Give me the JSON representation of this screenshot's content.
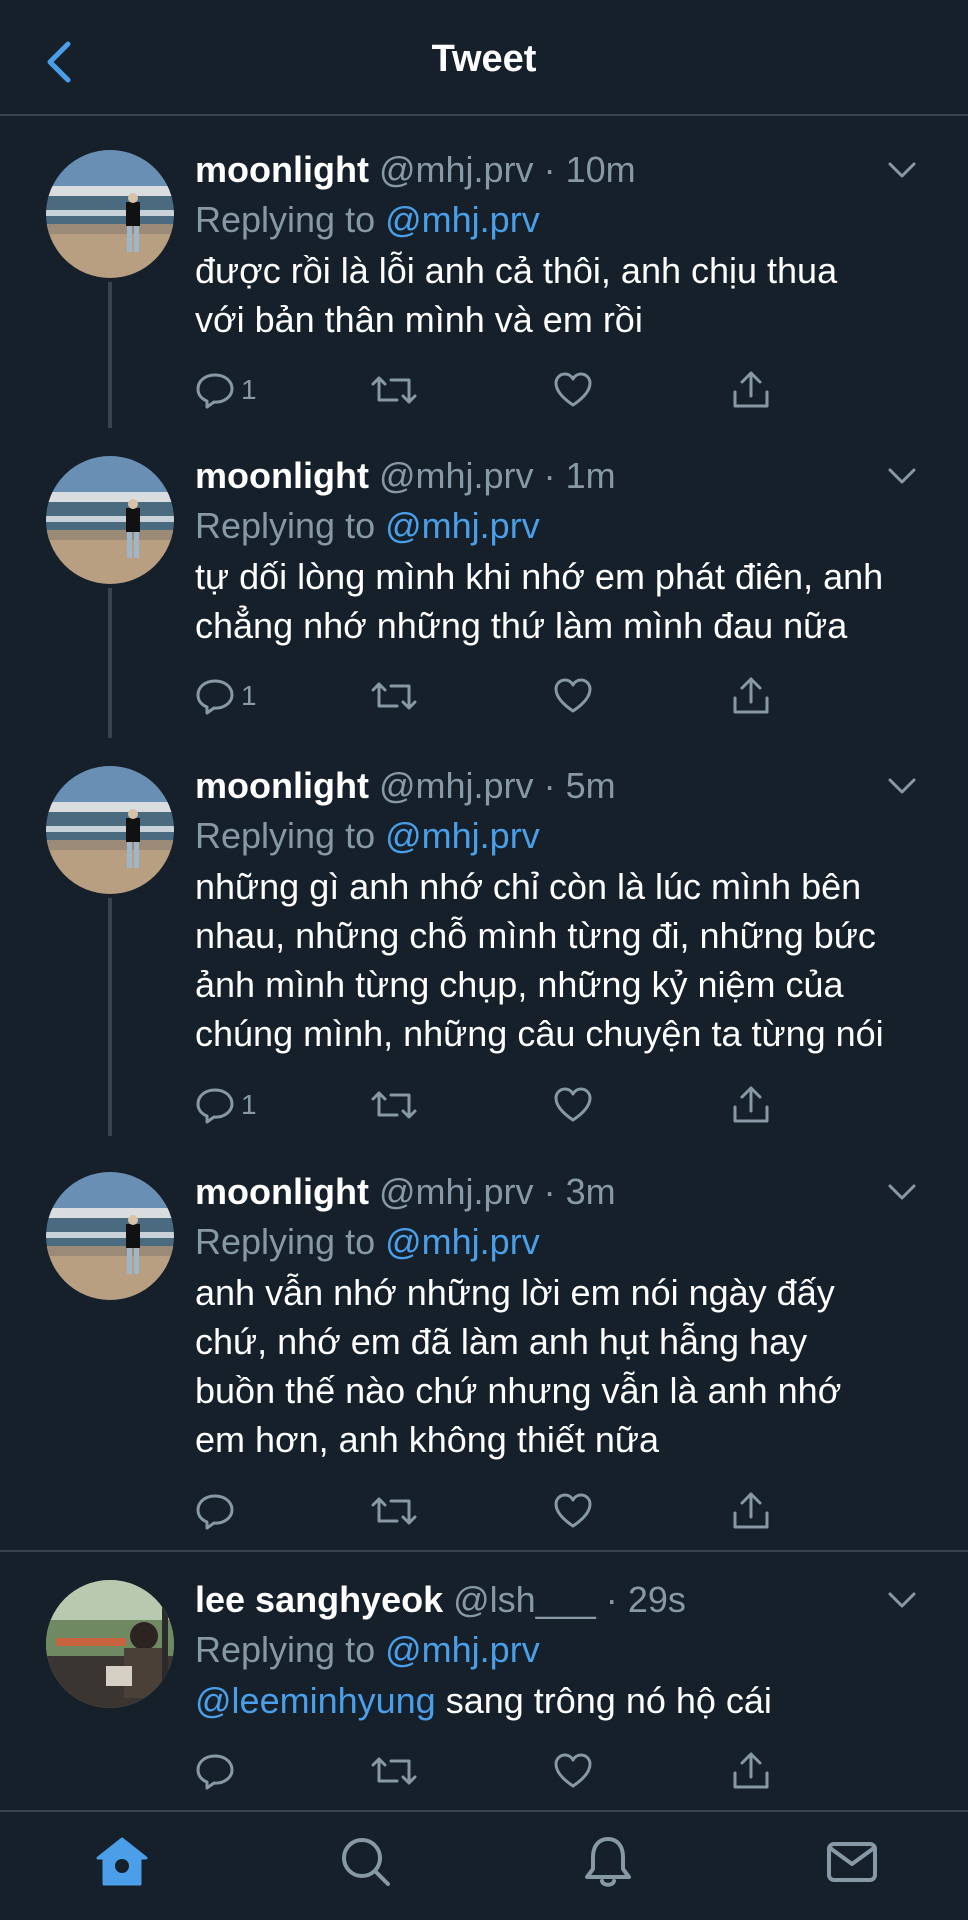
{
  "header": {
    "title": "Tweet",
    "back_icon": "chevron-left-icon"
  },
  "colors": {
    "background": "#15202b",
    "accent": "#4a9fe8",
    "secondary_text": "#8899a6",
    "divider": "#38444d"
  },
  "tweets": [
    {
      "name": "moonlight",
      "handle": "@mhj.prv",
      "separator": "·",
      "time": "10m",
      "replying_prefix": "Replying to",
      "replying_to": "@mhj.prv",
      "lines": [
        "được rồi là lỗi anh cả thôi, anh chịu thua",
        "với bản thân mình và em rồi"
      ],
      "reply_count": "1"
    },
    {
      "name": "moonlight",
      "handle": "@mhj.prv",
      "separator": "·",
      "time": "1m",
      "replying_prefix": "Replying to",
      "replying_to": "@mhj.prv",
      "lines": [
        "tự dối lòng mình khi nhớ em phát điên, anh",
        "chẳng nhớ những thứ làm mình đau nữa"
      ],
      "reply_count": "1"
    },
    {
      "name": "moonlight",
      "handle": "@mhj.prv",
      "separator": "·",
      "time": "5m",
      "replying_prefix": "Replying to",
      "replying_to": "@mhj.prv",
      "lines": [
        "những gì anh nhớ chỉ còn là lúc mình bên",
        "nhau, những chỗ mình từng đi, những bức",
        "ảnh mình từng chụp, những kỷ niệm của",
        "chúng mình, những câu chuyện ta từng nói"
      ],
      "reply_count": "1"
    },
    {
      "name": "moonlight",
      "handle": "@mhj.prv",
      "separator": "·",
      "time": "3m",
      "replying_prefix": "Replying to",
      "replying_to": "@mhj.prv",
      "lines": [
        "anh vẫn nhớ những lời em nói ngày đấy",
        "chứ, nhớ em đã làm anh hụt hẫng hay",
        "buồn thế nào chứ nhưng vẫn là anh nhớ",
        "em hơn, anh không thiết nữa"
      ],
      "reply_count": ""
    },
    {
      "name": "lee sanghyeok",
      "handle": "@lsh___",
      "separator": "·",
      "time": "29s",
      "replying_prefix": "Replying to",
      "replying_to": "@mhj.prv",
      "mention": "@leeminhyung",
      "text": " sang trông nó hộ cái",
      "reply_count": ""
    }
  ],
  "action_icons": [
    "reply-icon",
    "retweet-icon",
    "like-icon",
    "share-icon"
  ],
  "tabbar": [
    "home-icon",
    "search-icon",
    "notifications-icon",
    "messages-icon"
  ]
}
